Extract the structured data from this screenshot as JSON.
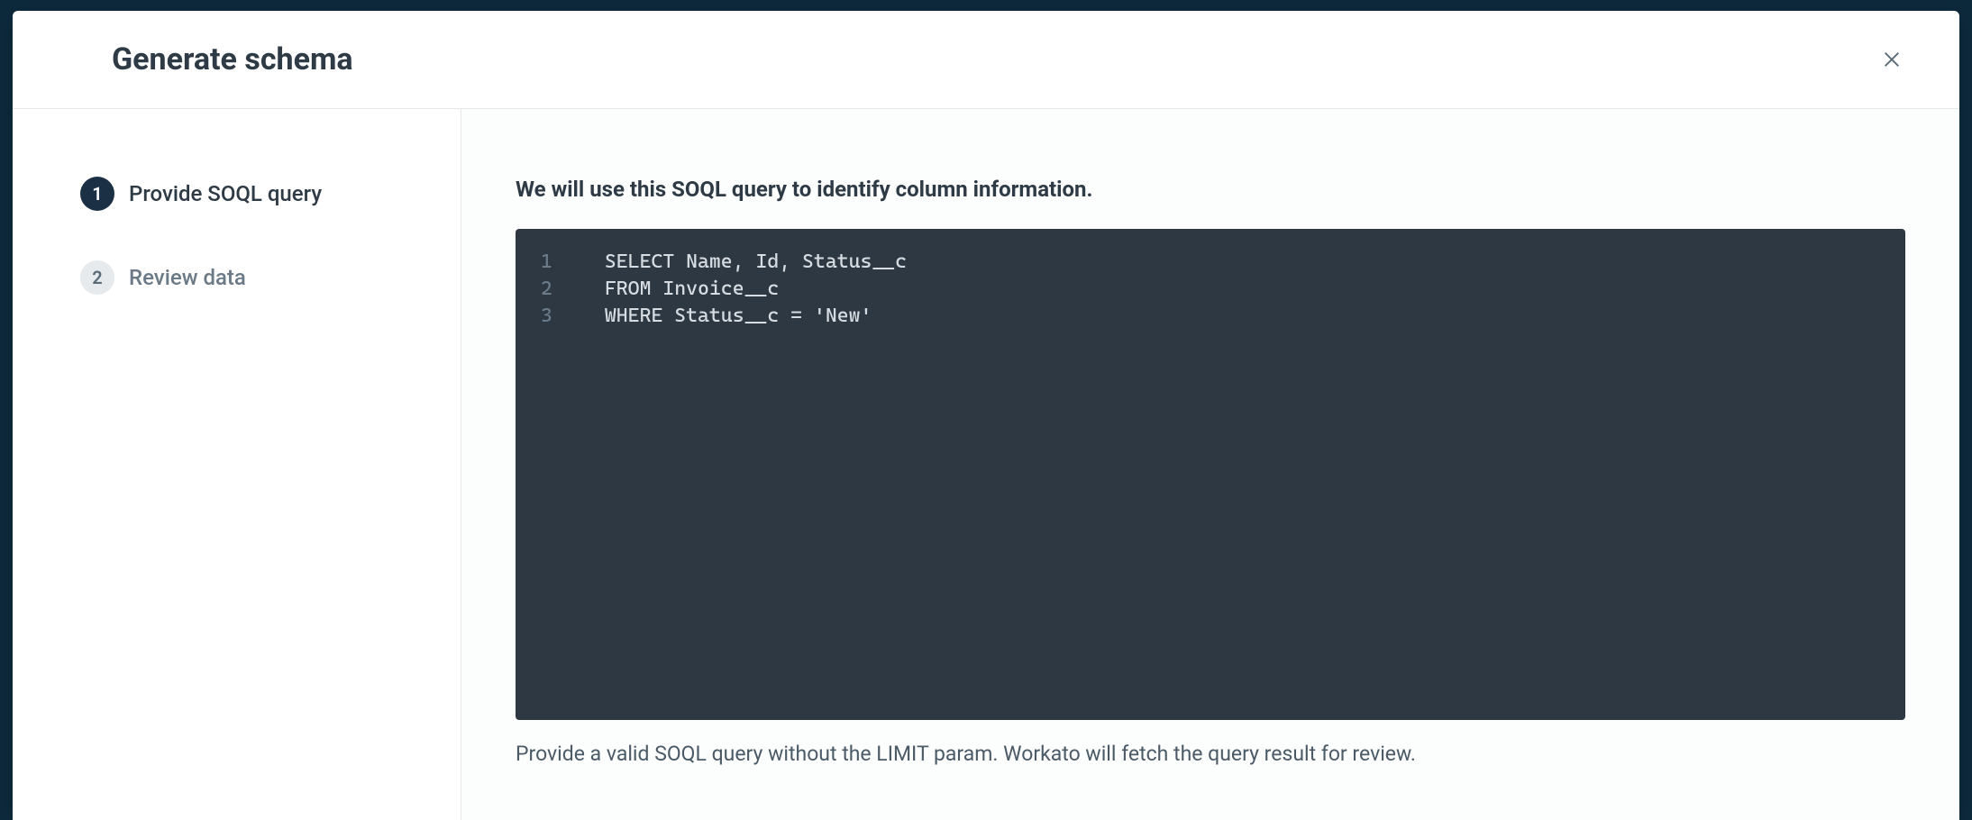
{
  "modal": {
    "title": "Generate schema"
  },
  "sidebar": {
    "steps": [
      {
        "num": "1",
        "label": "Provide SOQL query",
        "active": true
      },
      {
        "num": "2",
        "label": "Review data",
        "active": false
      }
    ]
  },
  "main": {
    "instruction": "We will use this SOQL query to identify column information.",
    "code": {
      "lines": [
        {
          "num": "1",
          "text": "SELECT Name, Id, Status__c"
        },
        {
          "num": "2",
          "text": "FROM Invoice__c"
        },
        {
          "num": "3",
          "text": "WHERE Status__c = 'New'"
        }
      ]
    },
    "hint": "Provide a valid SOQL query without the LIMIT param. Workato will fetch the query result for review."
  }
}
